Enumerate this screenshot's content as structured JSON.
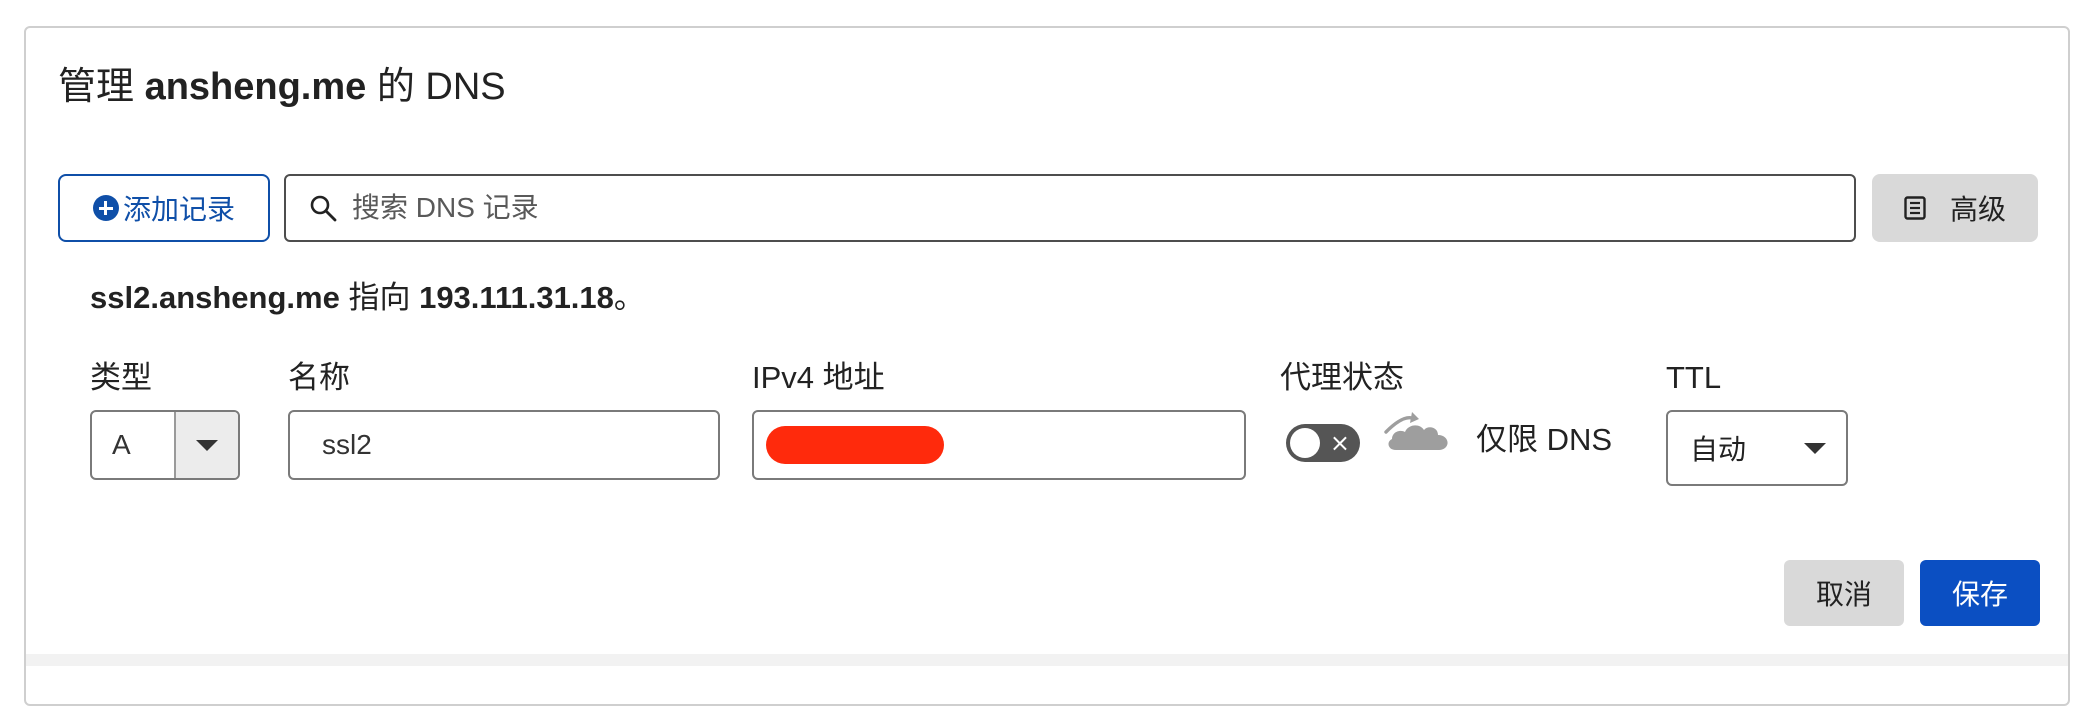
{
  "header": {
    "title_prefix": "管理 ",
    "domain": "ansheng.me",
    "title_suffix": " 的 DNS"
  },
  "toolbar": {
    "add_record_label": "添加记录",
    "search_placeholder": "搜索 DNS 记录",
    "advanced_label": "高级"
  },
  "hint": {
    "host": "ssl2.ansheng.me",
    "middle": " 指向 ",
    "ip": "193.111.31.18",
    "end": "。"
  },
  "form": {
    "type_label": "类型",
    "type_value": "A",
    "name_label": "名称",
    "name_value": "ssl2",
    "ipv4_label": "IPv4 地址",
    "ipv4_value": "",
    "proxy_label": "代理状态",
    "proxy_toggle_symbol": "×",
    "proxy_enabled": false,
    "proxy_status_text": "仅限 DNS",
    "ttl_label": "TTL",
    "ttl_value": "自动"
  },
  "actions": {
    "cancel_label": "取消",
    "save_label": "保存"
  },
  "colors": {
    "accent_blue": "#0f4fa8",
    "save_blue": "#0b4fc2",
    "redaction_red": "#ff2a0c",
    "toggle_off": "#555555",
    "cloud_gray": "#9e9e9e"
  },
  "icons": {
    "add": "plus-circle-icon",
    "search": "search-icon",
    "advanced": "document-icon",
    "proxy": "cloud-dns-only-icon",
    "dropdown": "chevron-down-icon"
  }
}
